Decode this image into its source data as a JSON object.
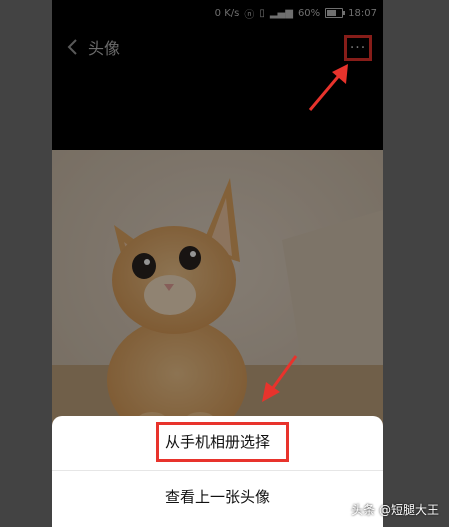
{
  "status_bar": {
    "speed": "0 K/s",
    "signal_text": "ᵃᵒ",
    "battery": "60%",
    "time": "18:07"
  },
  "title_bar": {
    "title": "头像",
    "more_label": "···"
  },
  "action_sheet": {
    "choose_from_album": "从手机相册选择",
    "view_previous": "查看上一张头像"
  },
  "watermark": "头条 @短腿大王",
  "colors": {
    "highlight": "#e8332c",
    "background": "#434343"
  }
}
